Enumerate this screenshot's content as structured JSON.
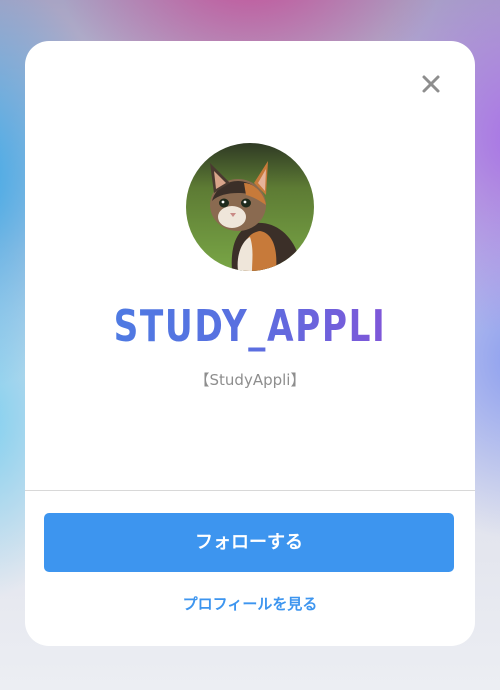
{
  "dialog": {
    "close_icon": "close-icon",
    "avatar": {
      "alt": "calico-kitten-photo",
      "colors": {
        "grass": "#6f9a3c",
        "fur_orange": "#c77a3a",
        "fur_dark": "#3b2f28",
        "fur_light": "#efe6da"
      }
    },
    "username": "STUDY_APPLI",
    "display_name": "【StudyAppli】",
    "follow_button_label": "フォローする",
    "view_profile_label": "プロフィールを見る"
  },
  "colors": {
    "accent": "#3d95ef",
    "username_gradient_start": "#4b7de3",
    "username_gradient_end": "#8a4fd6",
    "secondary_text": "#8e8e8e",
    "close_icon": "#8e8e8e"
  }
}
